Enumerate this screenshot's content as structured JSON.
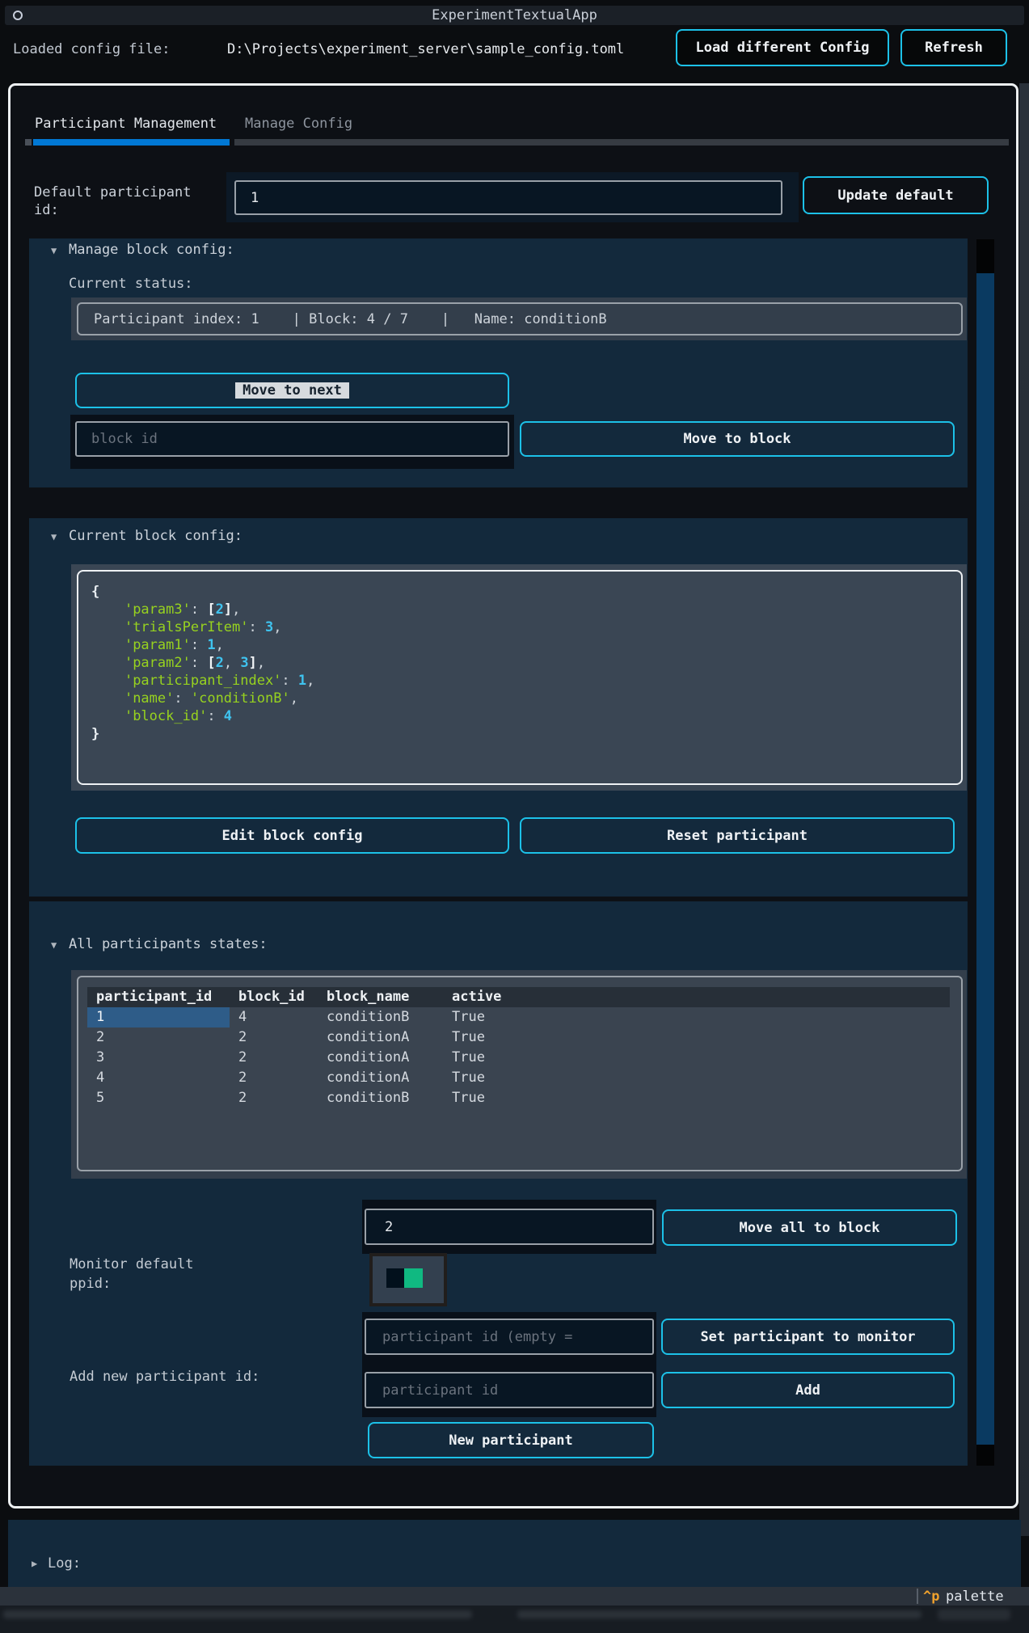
{
  "app": {
    "title": "ExperimentTextualApp"
  },
  "header": {
    "label": "Loaded config file:",
    "path": "D:\\Projects\\experiment_server\\sample_config.toml",
    "load_button": "Load different Config",
    "refresh_button": "Refresh"
  },
  "tabs": [
    {
      "label": "Participant Management",
      "active": true
    },
    {
      "label": "Manage Config",
      "active": false
    }
  ],
  "default_participant": {
    "label": "Default participant id:",
    "value": "1",
    "button": "Update default"
  },
  "manage_block": {
    "collapse_icon": "▼",
    "title": "Manage block config:",
    "status_label": "Current status:",
    "status_text": "Participant index: 1    | Block: 4 / 7    |   Name: conditionB",
    "move_next_button": "Move to next",
    "block_id_placeholder": "block id",
    "move_block_button": "Move to block"
  },
  "current_block": {
    "collapse_icon": "▼",
    "title": "Current block config:",
    "edit_button": "Edit block config",
    "reset_button": "Reset participant",
    "config_tokens": [
      [
        {
          "t": "{",
          "c": "brace"
        }
      ],
      [
        {
          "t": "    ",
          "c": "p"
        },
        {
          "t": "'param3'",
          "c": "key"
        },
        {
          "t": ": ",
          "c": "p"
        },
        {
          "t": "[",
          "c": "brk"
        },
        {
          "t": "2",
          "c": "num"
        },
        {
          "t": "]",
          "c": "brk"
        },
        {
          "t": ",",
          "c": "p"
        }
      ],
      [
        {
          "t": "    ",
          "c": "p"
        },
        {
          "t": "'trialsPerItem'",
          "c": "key"
        },
        {
          "t": ": ",
          "c": "p"
        },
        {
          "t": "3",
          "c": "num"
        },
        {
          "t": ",",
          "c": "p"
        }
      ],
      [
        {
          "t": "    ",
          "c": "p"
        },
        {
          "t": "'param1'",
          "c": "key"
        },
        {
          "t": ": ",
          "c": "p"
        },
        {
          "t": "1",
          "c": "num"
        },
        {
          "t": ",",
          "c": "p"
        }
      ],
      [
        {
          "t": "    ",
          "c": "p"
        },
        {
          "t": "'param2'",
          "c": "key"
        },
        {
          "t": ": ",
          "c": "p"
        },
        {
          "t": "[",
          "c": "brk"
        },
        {
          "t": "2",
          "c": "num"
        },
        {
          "t": ", ",
          "c": "p"
        },
        {
          "t": "3",
          "c": "num"
        },
        {
          "t": "]",
          "c": "brk"
        },
        {
          "t": ",",
          "c": "p"
        }
      ],
      [
        {
          "t": "    ",
          "c": "p"
        },
        {
          "t": "'participant_index'",
          "c": "key"
        },
        {
          "t": ": ",
          "c": "p"
        },
        {
          "t": "1",
          "c": "num"
        },
        {
          "t": ",",
          "c": "p"
        }
      ],
      [
        {
          "t": "    ",
          "c": "p"
        },
        {
          "t": "'name'",
          "c": "key"
        },
        {
          "t": ": ",
          "c": "p"
        },
        {
          "t": "'conditionB'",
          "c": "key"
        },
        {
          "t": ",",
          "c": "p"
        }
      ],
      [
        {
          "t": "    ",
          "c": "p"
        },
        {
          "t": "'block_id'",
          "c": "key"
        },
        {
          "t": ": ",
          "c": "p"
        },
        {
          "t": "4",
          "c": "num"
        }
      ],
      [
        {
          "t": "}",
          "c": "brace"
        }
      ]
    ]
  },
  "participants": {
    "collapse_icon": "▼",
    "title": "All participants states:",
    "table": {
      "columns": [
        "participant_id",
        "block_id",
        "block_name",
        "active"
      ],
      "rows": [
        [
          "1",
          "4",
          "conditionB",
          "True"
        ],
        [
          "2",
          "2",
          "conditionA",
          "True"
        ],
        [
          "3",
          "2",
          "conditionA",
          "True"
        ],
        [
          "4",
          "2",
          "conditionA",
          "True"
        ],
        [
          "5",
          "2",
          "conditionB",
          "True"
        ]
      ],
      "selected_cell": {
        "row": 0,
        "col": 0
      }
    },
    "move_all": {
      "value": "2",
      "button": "Move all to block"
    },
    "monitor": {
      "label": "Monitor default ppid:",
      "switch_on": true
    },
    "set_monitor": {
      "placeholder": "participant id (empty =",
      "button": "Set participant to monitor"
    },
    "add": {
      "label": "Add new participant id:",
      "placeholder": "participant id",
      "button": "Add"
    },
    "new_participant_button": "New participant"
  },
  "log": {
    "collapse_icon": "▶",
    "title": "Log:"
  },
  "footer": {
    "key": "^p",
    "action": "palette"
  },
  "colors": {
    "accent": "#1cc1e8",
    "primary": "#0178d4",
    "success": "#10b981",
    "section": "#13293c",
    "panel": "#3a4654",
    "keygreen": "#97d21f",
    "numcyan": "#3fc3ef",
    "selcell": "#2e5c88",
    "orange": "#efa12d",
    "scroll": "#0a3a61"
  }
}
